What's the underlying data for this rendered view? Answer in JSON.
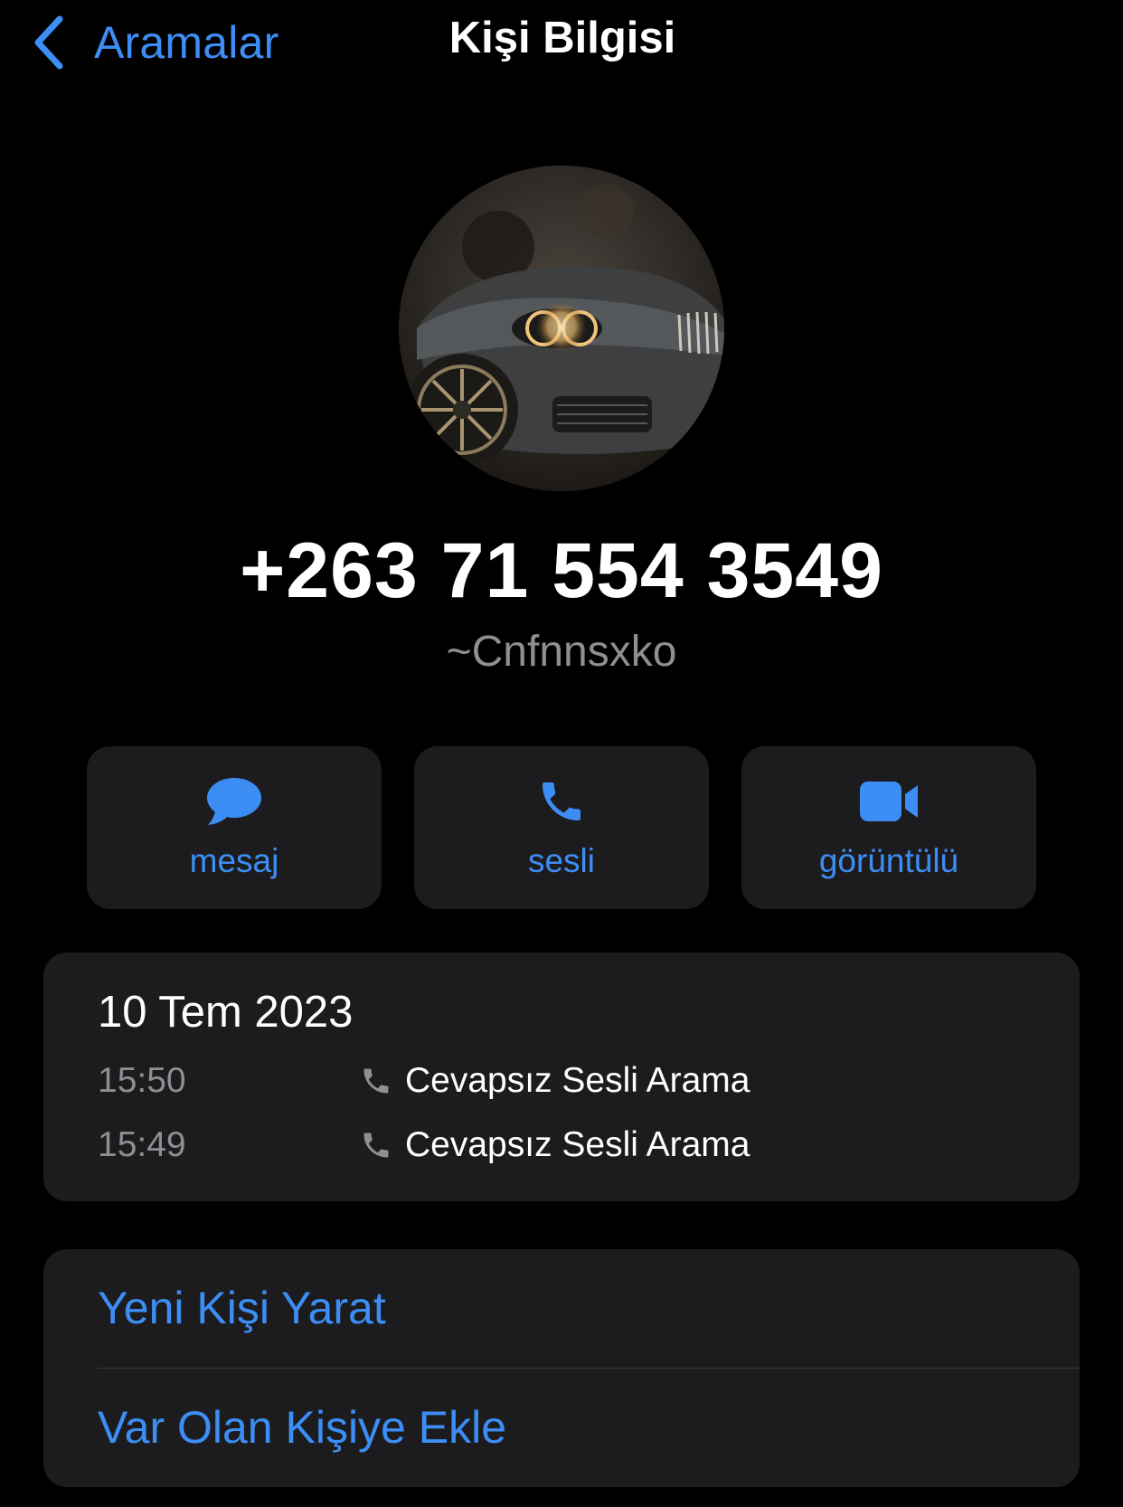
{
  "nav": {
    "back_label": "Aramalar",
    "title": "Kişi Bilgisi"
  },
  "contact": {
    "phone": "+263 71 554 3549",
    "nickname": "~Cnfnnsxko"
  },
  "actions": [
    {
      "label": "mesaj",
      "icon": "message-bubble-icon"
    },
    {
      "label": "sesli",
      "icon": "phone-icon"
    },
    {
      "label": "görüntülü",
      "icon": "video-camera-icon"
    }
  ],
  "history": {
    "date": "10 Tem 2023",
    "calls": [
      {
        "time": "15:50",
        "type": "Cevapsız Sesli Arama",
        "icon": "phone-icon"
      },
      {
        "time": "15:49",
        "type": "Cevapsız Sesli Arama",
        "icon": "phone-icon"
      }
    ]
  },
  "contact_actions": {
    "create_new": "Yeni Kişi Yarat",
    "add_existing": "Var Olan Kişiye Ekle"
  },
  "colors": {
    "accent": "#3c8ef5",
    "background": "#000000",
    "card": "#1c1c1e",
    "secondary_text": "#8e8e93"
  }
}
